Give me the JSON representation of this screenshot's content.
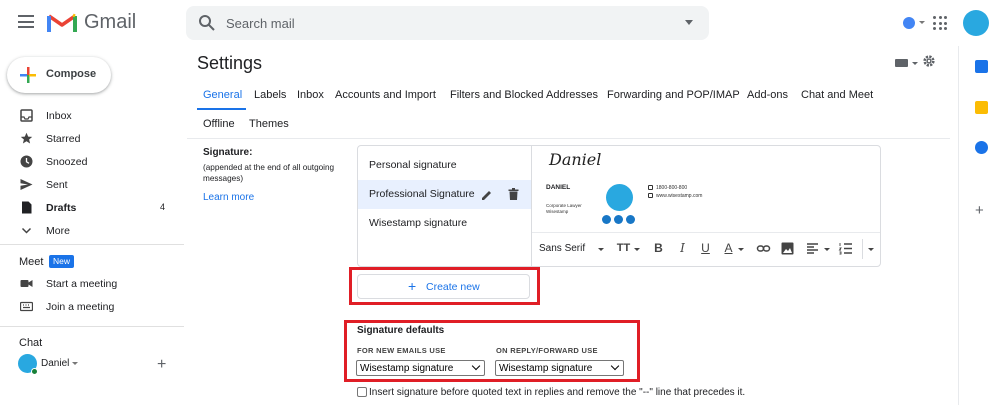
{
  "app": {
    "name": "Gmail"
  },
  "search": {
    "placeholder": "Search mail"
  },
  "compose": {
    "label": "Compose"
  },
  "nav": {
    "items": [
      {
        "label": "Inbox",
        "count": ""
      },
      {
        "label": "Starred",
        "count": ""
      },
      {
        "label": "Snoozed",
        "count": ""
      },
      {
        "label": "Sent",
        "count": ""
      },
      {
        "label": "Drafts",
        "count": "4"
      },
      {
        "label": "More",
        "count": ""
      }
    ]
  },
  "meet": {
    "title": "Meet",
    "badge": "New",
    "items": [
      {
        "label": "Start a meeting"
      },
      {
        "label": "Join a meeting"
      }
    ]
  },
  "chat": {
    "title": "Chat",
    "user": "Daniel"
  },
  "settings": {
    "title": "Settings",
    "tabs": [
      "General",
      "Labels",
      "Inbox",
      "Accounts and Import",
      "Filters and Blocked Addresses",
      "Forwarding and POP/IMAP",
      "Add-ons",
      "Chat and Meet",
      "Offline",
      "Themes"
    ],
    "signature": {
      "label": "Signature:",
      "help": "(appended at the end of all outgoing messages)",
      "learn_more": "Learn more",
      "items": [
        "Personal signature",
        "Professional Signature",
        "Wisestamp signature"
      ],
      "selected_index": 1,
      "preview": {
        "script_name": "Daniel",
        "name": "DANIEL",
        "role": "Corporate Lawyer",
        "company": "Wisestamp",
        "phone": "1800-800-800",
        "website": "www.wisestamp.com"
      },
      "toolbar": {
        "font": "Sans Serif"
      },
      "create_new": "Create new"
    },
    "defaults": {
      "title": "Signature defaults",
      "new_label": "FOR NEW EMAILS USE",
      "new_value": "Wisestamp signature",
      "reply_label": "ON REPLY/FORWARD USE",
      "reply_value": "Wisestamp signature",
      "insert_label": "Insert signature before quoted text in replies and remove the \"--\" line that precedes it."
    }
  },
  "colors": {
    "accent": "#1a73e8",
    "highlight_box": "#e01e26",
    "selected_bg": "#e8f0fe"
  }
}
